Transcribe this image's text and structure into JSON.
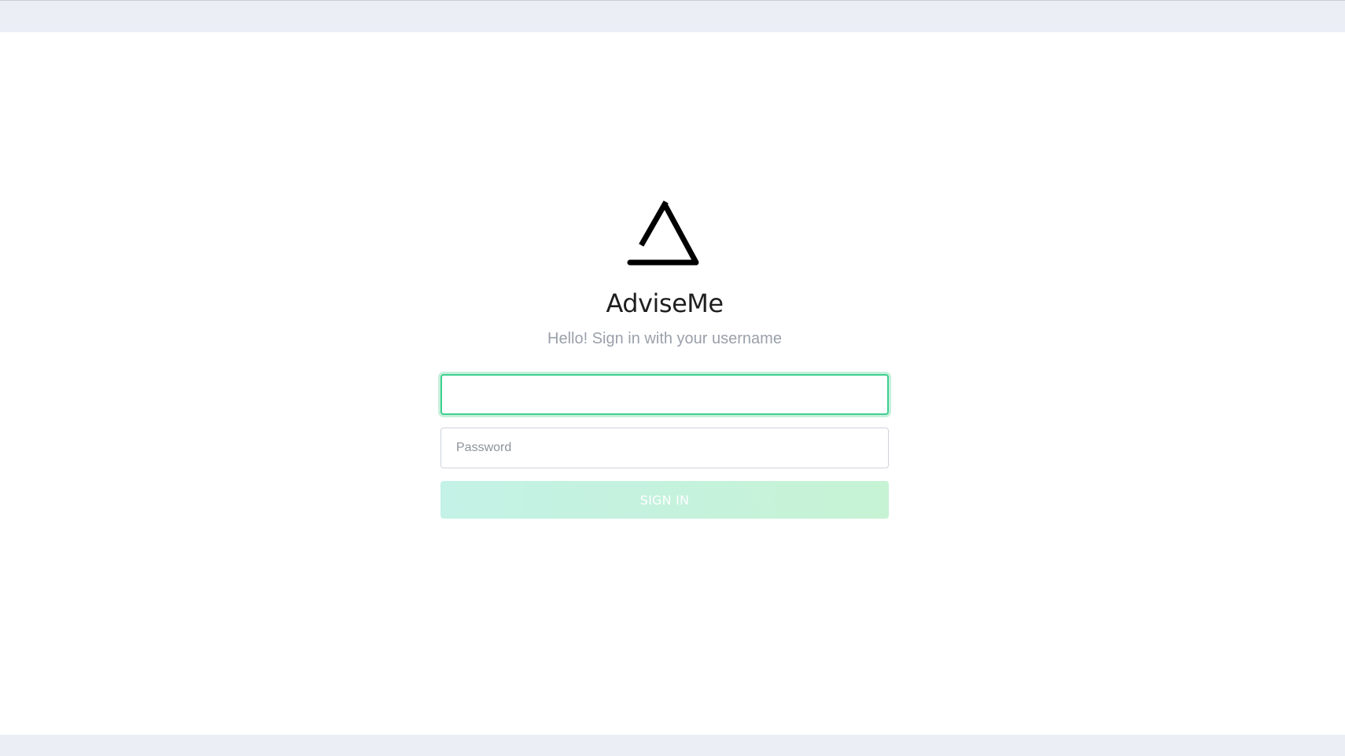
{
  "app": {
    "name": "AdviseMe",
    "subtitle": "Hello! Sign in with your username"
  },
  "login_form": {
    "username": {
      "value": "",
      "placeholder": ""
    },
    "password": {
      "value": "",
      "placeholder": "Password"
    },
    "sign_in_label": "SIGN IN"
  },
  "icons": {
    "logo": "triangle-logo-icon"
  },
  "colors": {
    "accent": "#3ecf8e",
    "button_start": "#c4f2e6",
    "button_end": "#c6f3d4",
    "subtitle": "#9aa0aa"
  }
}
